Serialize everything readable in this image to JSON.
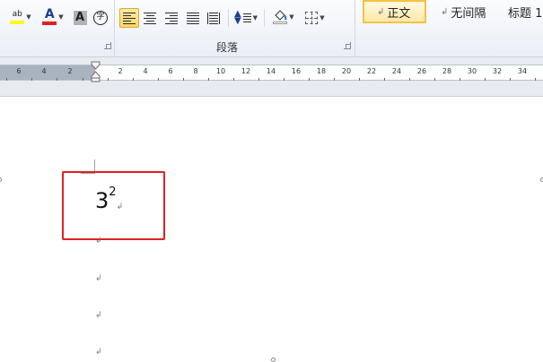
{
  "ribbon": {
    "font_group": {
      "highlight_icon": "text-highlight-icon",
      "highlight_label": "ab",
      "highlight_color": "#ffff00",
      "font_color_label": "A",
      "font_color": "#e02020",
      "char_shading_label": "A",
      "enclose_char_label": "字"
    },
    "paragraph_group": {
      "label": "段落",
      "align_left_active": true
    },
    "styles_group": {
      "styles": [
        {
          "label": "正文",
          "selected": true
        },
        {
          "label": "无间隔",
          "selected": false
        },
        {
          "label": "标题 1",
          "selected": false
        }
      ],
      "para_mark": "↲"
    }
  },
  "ruler": {
    "numbers": [
      "6",
      "4",
      "2",
      "2",
      "4",
      "6",
      "8",
      "10",
      "12",
      "14",
      "16",
      "18",
      "20",
      "22",
      "24",
      "26",
      "28",
      "30",
      "32",
      "34"
    ]
  },
  "document": {
    "formula_base": "3",
    "formula_exponent": "2",
    "para_mark": "↲",
    "highlight_color": "#e02020"
  }
}
